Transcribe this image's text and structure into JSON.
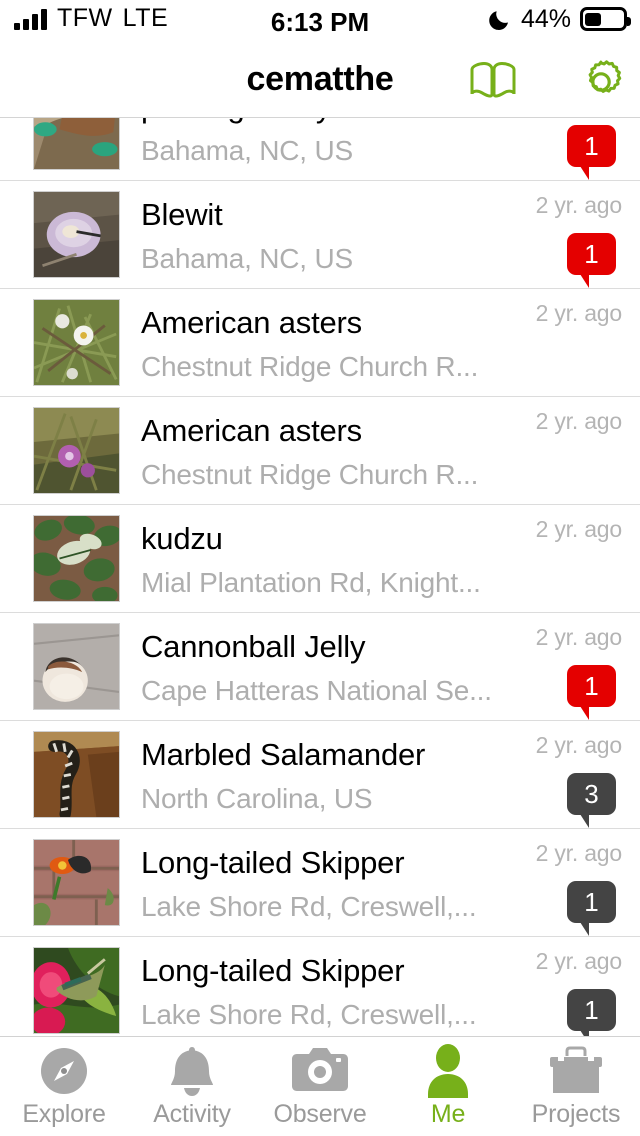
{
  "statusbar": {
    "carrier": "TFW",
    "network": "LTE",
    "time": "6:13 PM",
    "battery_percent": "44%",
    "battery_level": 44,
    "dnd_icon": "moon-icon",
    "signal_icon": "signal-bars-icon"
  },
  "navbar": {
    "title": "cematthe",
    "accent_color": "#77b01a",
    "actions": [
      {
        "name": "guide-button",
        "icon": "book-icon"
      },
      {
        "name": "settings-button",
        "icon": "gear-icon"
      }
    ]
  },
  "observations": [
    {
      "title": "partridgeberry",
      "place": "Bahama, NC, US",
      "time": "",
      "badge": {
        "count": "1",
        "style": "red"
      },
      "thumb": "partridgeberry-thumbnail"
    },
    {
      "title": "Blewit",
      "place": "Bahama, NC, US",
      "time": "2 yr. ago",
      "badge": {
        "count": "1",
        "style": "red"
      },
      "thumb": "blewit-mushroom-thumbnail"
    },
    {
      "title": "American asters",
      "place": "Chestnut Ridge Church R...",
      "time": "2 yr. ago",
      "badge": null,
      "thumb": "white-aster-thumbnail"
    },
    {
      "title": "American asters",
      "place": "Chestnut Ridge Church R...",
      "time": "2 yr. ago",
      "badge": null,
      "thumb": "purple-aster-thumbnail"
    },
    {
      "title": "kudzu",
      "place": "Mial Plantation Rd, Knight...",
      "time": "2 yr. ago",
      "badge": null,
      "thumb": "kudzu-leaves-thumbnail"
    },
    {
      "title": "Cannonball Jelly",
      "place": "Cape Hatteras National Se...",
      "time": "2 yr. ago",
      "badge": {
        "count": "1",
        "style": "red"
      },
      "thumb": "cannonball-jelly-thumbnail"
    },
    {
      "title": "Marbled Salamander",
      "place": "North Carolina, US",
      "time": "2 yr. ago",
      "badge": {
        "count": "3",
        "style": "gray"
      },
      "thumb": "marbled-salamander-thumbnail"
    },
    {
      "title": "Long-tailed Skipper",
      "place": "Lake Shore Rd, Creswell,...",
      "time": "2 yr. ago",
      "badge": {
        "count": "1",
        "style": "gray"
      },
      "thumb": "skipper-on-brick-thumbnail"
    },
    {
      "title": "Long-tailed Skipper",
      "place": "Lake Shore Rd, Creswell,...",
      "time": "2 yr. ago",
      "badge": {
        "count": "1",
        "style": "gray"
      },
      "thumb": "skipper-on-flower-thumbnail"
    }
  ],
  "tabbar": {
    "active": "Me",
    "items": [
      {
        "label": "Explore",
        "icon": "compass-icon",
        "name": "tab-explore"
      },
      {
        "label": "Activity",
        "icon": "bell-icon",
        "name": "tab-activity"
      },
      {
        "label": "Observe",
        "icon": "camera-icon",
        "name": "tab-observe"
      },
      {
        "label": "Me",
        "icon": "person-icon",
        "name": "tab-me"
      },
      {
        "label": "Projects",
        "icon": "toolbox-icon",
        "name": "tab-projects"
      }
    ]
  }
}
